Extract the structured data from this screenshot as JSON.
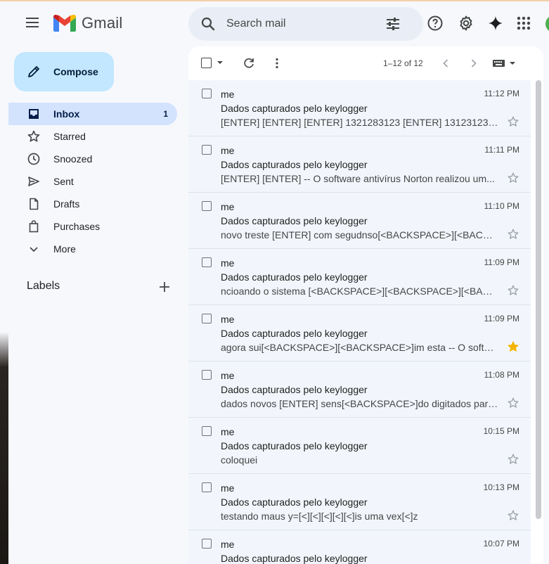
{
  "header": {
    "app_name": "Gmail",
    "search_placeholder": "Search mail",
    "icons": [
      "menu-icon",
      "search-icon",
      "tune-icon",
      "help-icon",
      "gear-icon",
      "gemini-sparkle-icon",
      "apps-grid-icon"
    ]
  },
  "compose": {
    "label": "Compose"
  },
  "nav": {
    "items": [
      {
        "label": "Inbox",
        "icon": "inbox-icon",
        "count": "1",
        "active": true
      },
      {
        "label": "Starred",
        "icon": "star-icon",
        "count": ""
      },
      {
        "label": "Snoozed",
        "icon": "clock-icon",
        "count": ""
      },
      {
        "label": "Sent",
        "icon": "send-icon",
        "count": ""
      },
      {
        "label": "Drafts",
        "icon": "draft-icon",
        "count": ""
      },
      {
        "label": "Purchases",
        "icon": "bag-icon",
        "count": ""
      },
      {
        "label": "More",
        "icon": "chevron-down-icon",
        "count": ""
      }
    ]
  },
  "labels": {
    "heading": "Labels"
  },
  "toolbar": {
    "pager": "1–12 of 12"
  },
  "emails": [
    {
      "sender": "me",
      "subject": "Dados capturados pelo keylogger",
      "snippet": "[ENTER] [ENTER] [ENTER] 1321283123 [ENTER] 131231231242...",
      "time": "11:12 PM",
      "starred": false
    },
    {
      "sender": "me",
      "subject": "Dados capturados pelo keylogger",
      "snippet": "[ENTER] [ENTER] -- O software antivírus Norton realizou um...",
      "time": "11:11 PM",
      "starred": false
    },
    {
      "sender": "me",
      "subject": "Dados capturados pelo keylogger",
      "snippet": "novo treste [ENTER] com segudnso[<BACKSPACE>][<BACKS...",
      "time": "11:10 PM",
      "starred": false
    },
    {
      "sender": "me",
      "subject": "Dados capturados pelo keylogger",
      "snippet": "ncioando o sistema [<BACKSPACE>][<BACKSPACE>][<BACK...",
      "time": "11:09 PM",
      "starred": false
    },
    {
      "sender": "me",
      "subject": "Dados capturados pelo keylogger",
      "snippet": "agora sui[<BACKSPACE>][<BACKSPACE>]im esta -- O softwa...",
      "time": "11:09 PM",
      "starred": true
    },
    {
      "sender": "me",
      "subject": "Dados capturados pelo keylogger",
      "snippet": "dados novos [ENTER] sens[<BACKSPACE>]do digitados para ...",
      "time": "11:08 PM",
      "starred": false
    },
    {
      "sender": "me",
      "subject": "Dados capturados pelo keylogger",
      "snippet": "coloquei",
      "time": "10:15 PM",
      "starred": false
    },
    {
      "sender": "me",
      "subject": "Dados capturados pelo keylogger",
      "snippet": "testando maus y=[<][<][<][<][<]is uma vex[<]z",
      "time": "10:13 PM",
      "starred": false
    },
    {
      "sender": "me",
      "subject": "Dados capturados pelo keylogger",
      "snippet": "",
      "time": "10:07 PM",
      "starred": false
    }
  ],
  "colors": {
    "star_active": "#f4b400",
    "inbox_active_bg": "#d3e3fd",
    "compose_bg": "#c2e7ff"
  }
}
